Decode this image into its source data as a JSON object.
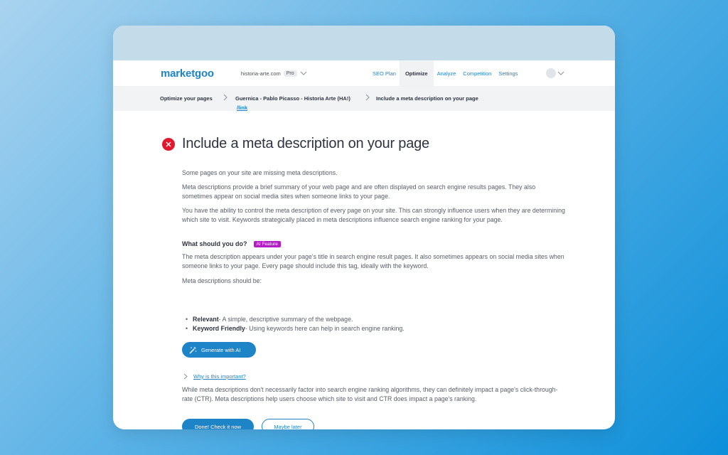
{
  "app": {
    "logo": "marketgoo",
    "site": "historia-arte.com",
    "plan_badge": "Pro"
  },
  "nav": {
    "items": [
      {
        "label": "SEO Plan",
        "active": false
      },
      {
        "label": "Optimize",
        "active": true
      },
      {
        "label": "Analyze",
        "active": false
      },
      {
        "label": "Competition",
        "active": false
      },
      {
        "label": "Settings",
        "active": false
      }
    ]
  },
  "breadcrumb": {
    "root": "Optimize your pages",
    "page": "Guernica - Pablo Picasso - Historia Arte (HA!)",
    "page_path": "/link",
    "current": "Include a meta description on your page"
  },
  "task": {
    "status_icon": "error-x-icon",
    "title": "Include a meta description on your page",
    "intro": "Some pages on your site are missing meta descriptions.",
    "para1": "Meta descriptions provide a brief summary of your web page and are often displayed on search engine results pages. They also sometimes appear on social media sites when someone links to your page.",
    "para2": "You have the ability to control the meta description of every page on your site. This can strongly influence users when they are determining which site to visit. Keywords strategically placed in meta descriptions influence search engine ranking for your page.",
    "what_heading": "What should you do?",
    "ai_badge": "AI Feature",
    "what_para": "The meta description appears under your page's title in search engine result pages. It also sometimes appears on social media sites when someone links to your page. Every page should include this tag, ideally with the keyword.",
    "should_be": "Meta descriptions should be:",
    "bullets": [
      {
        "term": "Relevant",
        "text": " - A simple, descriptive summary of the webpage."
      },
      {
        "term": "Keyword Friendly",
        "text": " - Using keywords here can help in search engine ranking."
      }
    ],
    "generate_label": "Generate with AI",
    "why_label": "Why is this important?",
    "why_para": "While meta descriptions don't necessarily factor into search engine ranking algorithms, they can definitely impact a page's click-through-rate (CTR). Meta descriptions help users choose which site to visit and CTR does impact a page's ranking.",
    "done_label": "Done! Check it now",
    "later_label": "Maybe later"
  },
  "colors": {
    "brand": "#1d84c8",
    "error": "#e2182c",
    "ai_badge": "#b31cc7"
  }
}
